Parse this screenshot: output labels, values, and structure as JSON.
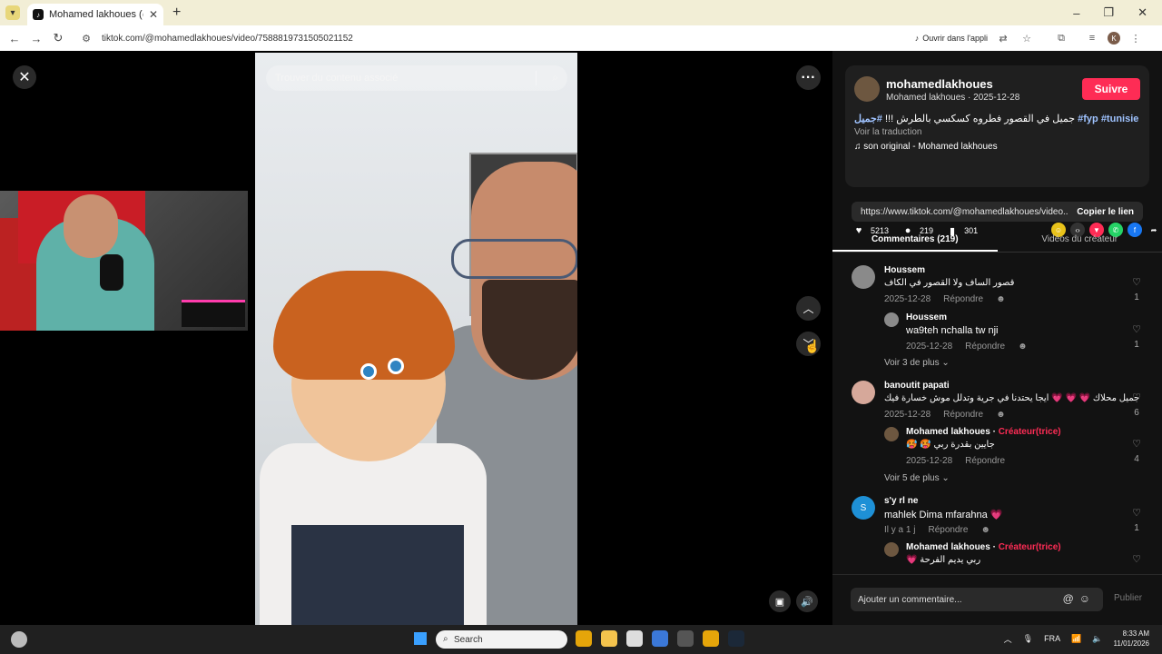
{
  "browser": {
    "tab_title": "Mohamed lakhoues (@mol",
    "url": "tiktok.com/@mohamedlakhoues/video/7588819731505021152",
    "open_app": "Ouvrir dans l'appli",
    "profile_initial": "K"
  },
  "video": {
    "search_placeholder": "Trouver du contenu associé"
  },
  "author": {
    "username": "mohamedlakhoues",
    "subline": "Mohamed lakhoues · 2025-12-28",
    "follow_label": "Suivre",
    "caption_text": "جميل في القصور فطروه كسكسي بالطرش !!! ",
    "tags": [
      "#جميل",
      "#fyp",
      "#tunisie"
    ],
    "translate_label": "Voir la traduction",
    "sound": "son original - Mohamed lakhoues"
  },
  "stats": {
    "likes": "5213",
    "comments": "219",
    "saves": "301"
  },
  "link": {
    "url_text": "https://www.tiktok.com/@mohamedlakhoues/video...",
    "copy_label": "Copier le lien"
  },
  "tabs": {
    "comments": "Commentaires (219)",
    "creator_videos": "Vidéos du créateur"
  },
  "comments": [
    {
      "name": "Houssem",
      "text": "قصور الساف ولا القصور في الكاف",
      "date": "2025-12-28",
      "reply": "Répondre",
      "likes": "1"
    },
    {
      "name": "Houssem",
      "text": "wa9teh nchalla tw nji",
      "date": "2025-12-28",
      "reply": "Répondre",
      "likes": "1"
    },
    {
      "more": "Voir 3 de plus"
    },
    {
      "name": "banoutit papati",
      "text": "جميل محلاك 💗 💗 💗 ايجا يحتدنا في جرية وتدلل موش خسارة فيك",
      "date": "2025-12-28",
      "reply": "Répondre",
      "likes": "6"
    },
    {
      "name": "Mohamed lakhoues",
      "creator": "Créateur(trice)",
      "text": "🥵 🥵 جايين بقدرة ربي",
      "date": "2025-12-28",
      "reply": "Répondre",
      "likes": "4"
    },
    {
      "more": "Voir 5 de plus"
    },
    {
      "name": "s'y rl ne",
      "avatar_letter": "S",
      "text": "mahlek Dima mfarahna 💗",
      "date": "Il y a 1 j",
      "reply": "Répondre",
      "likes": "1"
    },
    {
      "name": "Mohamed lakhoues",
      "creator": "Créateur(trice)",
      "text": "💗 ربي يديم الفرحة",
      "date": "",
      "reply": "",
      "likes": ""
    }
  ],
  "comment_box": {
    "placeholder": "Ajouter un commentaire...",
    "publish": "Publier"
  },
  "taskbar": {
    "search": "Search",
    "lang": "FRA",
    "time": "8:33 AM",
    "date": "11/01/2026"
  }
}
